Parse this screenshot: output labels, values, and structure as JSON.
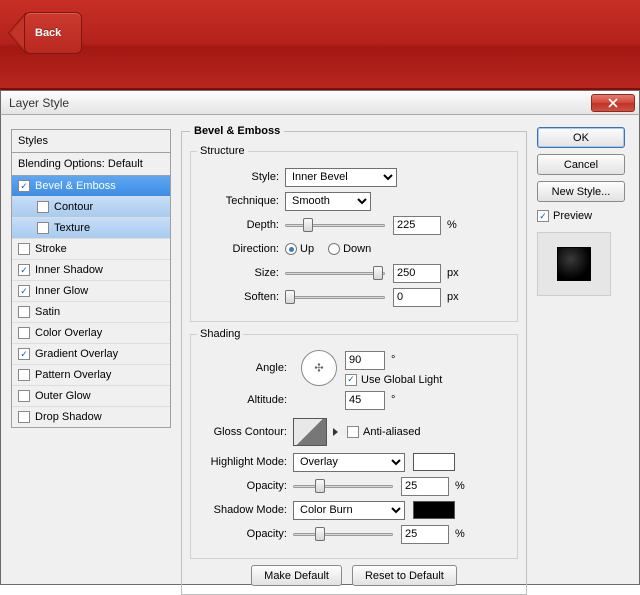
{
  "topbar": {
    "back_label": "Back"
  },
  "window": {
    "title": "Layer Style"
  },
  "sidebar": {
    "header": "Styles",
    "subheader": "Blending Options: Default",
    "items": [
      {
        "label": "Bevel & Emboss",
        "checked": true,
        "selected": true
      },
      {
        "label": "Contour",
        "checked": false,
        "sub": true,
        "selected_sub": true
      },
      {
        "label": "Texture",
        "checked": false,
        "sub": true,
        "selected_sub": true
      },
      {
        "label": "Stroke",
        "checked": false
      },
      {
        "label": "Inner Shadow",
        "checked": true
      },
      {
        "label": "Inner Glow",
        "checked": true
      },
      {
        "label": "Satin",
        "checked": false
      },
      {
        "label": "Color Overlay",
        "checked": false
      },
      {
        "label": "Gradient Overlay",
        "checked": true
      },
      {
        "label": "Pattern Overlay",
        "checked": false
      },
      {
        "label": "Outer Glow",
        "checked": false
      },
      {
        "label": "Drop Shadow",
        "checked": false
      }
    ]
  },
  "bevel": {
    "title": "Bevel & Emboss",
    "structure": {
      "legend": "Structure",
      "style_label": "Style:",
      "style_value": "Inner Bevel",
      "technique_label": "Technique:",
      "technique_value": "Smooth",
      "depth_label": "Depth:",
      "depth_value": "225",
      "depth_unit": "%",
      "direction_label": "Direction:",
      "up_label": "Up",
      "down_label": "Down",
      "direction": "up",
      "size_label": "Size:",
      "size_value": "250",
      "size_unit": "px",
      "soften_label": "Soften:",
      "soften_value": "0",
      "soften_unit": "px"
    },
    "shading": {
      "legend": "Shading",
      "angle_label": "Angle:",
      "angle_value": "90",
      "deg": "°",
      "global_light_label": "Use Global Light",
      "global_light": true,
      "altitude_label": "Altitude:",
      "altitude_value": "45",
      "gloss_label": "Gloss Contour:",
      "anti_label": "Anti-aliased",
      "anti": false,
      "hmode_label": "Highlight Mode:",
      "hmode_value": "Overlay",
      "hcolor": "#ffffff",
      "hopacity_label": "Opacity:",
      "hopacity_value": "25",
      "pct": "%",
      "smode_label": "Shadow Mode:",
      "smode_value": "Color Burn",
      "scolor": "#000000",
      "sopacity_label": "Opacity:",
      "sopacity_value": "25"
    },
    "make_default": "Make Default",
    "reset_default": "Reset to Default"
  },
  "right": {
    "ok": "OK",
    "cancel": "Cancel",
    "new_style": "New Style...",
    "preview_label": "Preview",
    "preview_checked": true
  }
}
